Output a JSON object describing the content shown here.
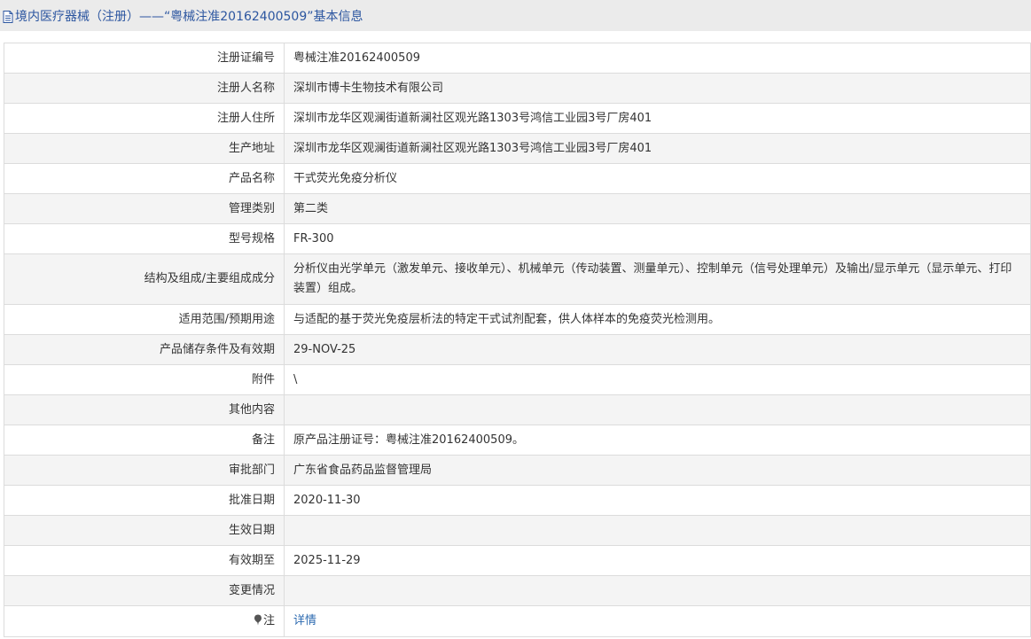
{
  "header": {
    "title": "境内医疗器械（注册）——“粤械注准20162400509”基本信息"
  },
  "rows": [
    {
      "label": "注册证编号",
      "value": "粤械注准20162400509"
    },
    {
      "label": "注册人名称",
      "value": "深圳市博卡生物技术有限公司"
    },
    {
      "label": "注册人住所",
      "value": "深圳市龙华区观澜街道新澜社区观光路1303号鸿信工业园3号厂房401"
    },
    {
      "label": "生产地址",
      "value": "深圳市龙华区观澜街道新澜社区观光路1303号鸿信工业园3号厂房401"
    },
    {
      "label": "产品名称",
      "value": "干式荧光免疫分析仪"
    },
    {
      "label": "管理类别",
      "value": "第二类"
    },
    {
      "label": "型号规格",
      "value": "FR-300"
    },
    {
      "label": "结构及组成/主要组成成分",
      "value": "分析仪由光学单元（激发单元、接收单元）、机械单元（传动装置、测量单元）、控制单元（信号处理单元）及输出/显示单元（显示单元、打印装置）组成。"
    },
    {
      "label": "适用范围/预期用途",
      "value": "与适配的基于荧光免疫层析法的特定干式试剂配套，供人体样本的免疫荧光检测用。"
    },
    {
      "label": "产品储存条件及有效期",
      "value": "29-NOV-25"
    },
    {
      "label": "附件",
      "value": "\\"
    },
    {
      "label": "其他内容",
      "value": ""
    },
    {
      "label": "备注",
      "value": "原产品注册证号：粤械注准20162400509。"
    },
    {
      "label": "审批部门",
      "value": "广东省食品药品监督管理局"
    },
    {
      "label": "批准日期",
      "value": "2020-11-30"
    },
    {
      "label": "生效日期",
      "value": ""
    },
    {
      "label": "有效期至",
      "value": "2025-11-29"
    },
    {
      "label": "变更情况",
      "value": ""
    }
  ],
  "note_row": {
    "label": "注",
    "link_text": "详情",
    "icon": "pin-icon"
  },
  "colors": {
    "title_text": "#2c56a0",
    "title_bg": "#ebebeb",
    "alt_row_bg": "#f4f4f4",
    "border": "#dcdcdc",
    "link": "#2c6ab0"
  }
}
